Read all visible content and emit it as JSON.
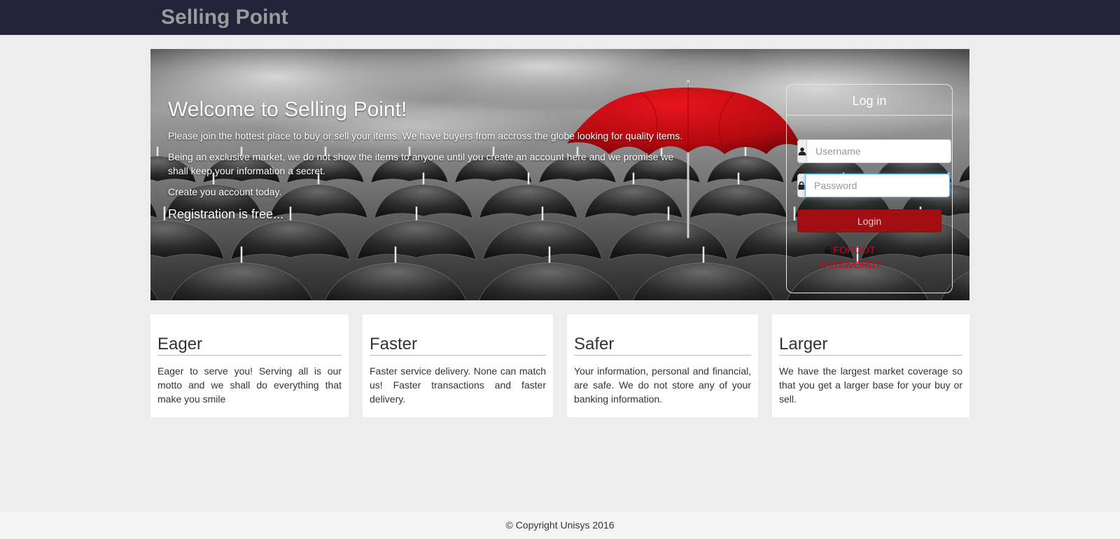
{
  "header": {
    "brand": "Selling Point"
  },
  "hero": {
    "title": "Welcome to Selling Point!",
    "paragraphs": [
      "Please join the hottest place to buy or sell your items. We have buyers from accross the globe looking for quality items.",
      "Being an exclusive market, we do not show the items to anyone until you create an account here and we promise we shall keep your information a secret.",
      "Create you account today."
    ],
    "lead": "Registration is free..."
  },
  "login": {
    "title": "Log in",
    "username_placeholder": "Username",
    "password_placeholder": "Password",
    "username_value": "",
    "password_value": "",
    "button_label": "Login",
    "forgot_label": "FORGOT PASSWORD?",
    "icons": {
      "username": "user-icon",
      "password": "lock-icon",
      "forgot": "lock-icon"
    }
  },
  "features": [
    {
      "title": "Eager",
      "text": "Eager to serve you! Serving all is our motto and we shall do everything that make you smile"
    },
    {
      "title": "Faster",
      "text": "Faster service delivery. None can match us! Faster transactions and faster delivery."
    },
    {
      "title": "Safer",
      "text": "Your information, personal and financial, are safe. We do not store any of your banking information."
    },
    {
      "title": "Larger",
      "text": "We have the largest market coverage so that you get a larger base for your buy or sell."
    }
  ],
  "footer": {
    "copyright": "© Copyright Unisys 2016"
  },
  "colors": {
    "navbar": "#23243a",
    "accent": "#a30e12",
    "link": "#d0021b",
    "umbrella_red": "#c40d14"
  }
}
